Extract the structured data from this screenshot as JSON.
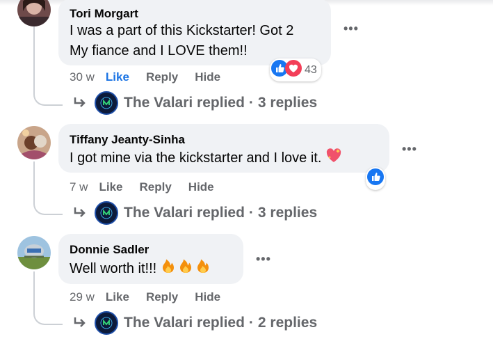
{
  "comments": [
    {
      "author": "Tori Morgart",
      "text_line1": "I was a part of this Kickstarter! Got 2",
      "text_line2": "My fiance and I LOVE them!!",
      "time": "30 w",
      "like": "Like",
      "reply": "Reply",
      "hide": "Hide",
      "reaction_count": "43",
      "reactions": [
        "like-icon",
        "love-icon"
      ],
      "liked": true,
      "replied_by": "The Valari replied",
      "replies_count": "3 replies"
    },
    {
      "author": "Tiffany Jeanty-Sinha",
      "text": "I got mine via the kickstarter and I love it.",
      "emoji": "sparkling-heart",
      "time": "7 w",
      "like": "Like",
      "reply": "Reply",
      "hide": "Hide",
      "reactions": [
        "like-icon"
      ],
      "liked": false,
      "replied_by": "The Valari replied",
      "replies_count": "3 replies"
    },
    {
      "author": "Donnie Sadler",
      "text": "Well worth it!!!",
      "emoji": "fire-x3",
      "time": "29 w",
      "like": "Like",
      "reply": "Reply",
      "hide": "Hide",
      "liked": false,
      "replied_by": "The Valari replied",
      "replies_count": "2 replies"
    }
  ],
  "more_label": "•••",
  "separator": "·",
  "colors": {
    "bubble": "#f0f2f5",
    "meta": "#65676b",
    "liked": "#1b74e4",
    "thread_line": "#ccd0d5"
  }
}
